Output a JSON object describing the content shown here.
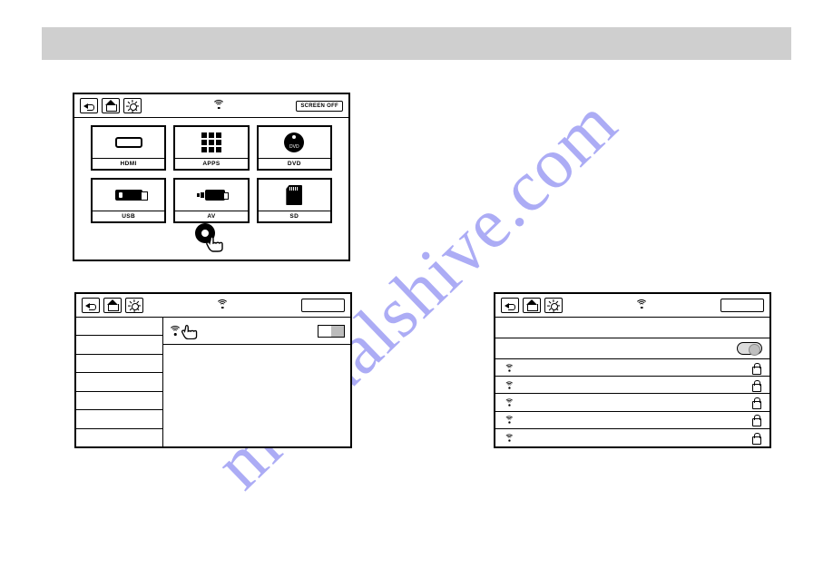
{
  "watermark": "manualshive.com",
  "panel_home": {
    "screen_off_label": "SCREEN OFF",
    "tiles": [
      {
        "label": "HDMI"
      },
      {
        "label": "APPS"
      },
      {
        "label": "DVD"
      },
      {
        "label": "USB"
      },
      {
        "label": "AV"
      },
      {
        "label": "SD"
      }
    ]
  },
  "panel_settings": {
    "sidebar_rows": 7
  },
  "panel_wifilist": {
    "networks": [
      {
        "locked": true
      },
      {
        "locked": true
      },
      {
        "locked": true
      },
      {
        "locked": true
      },
      {
        "locked": true
      }
    ]
  }
}
